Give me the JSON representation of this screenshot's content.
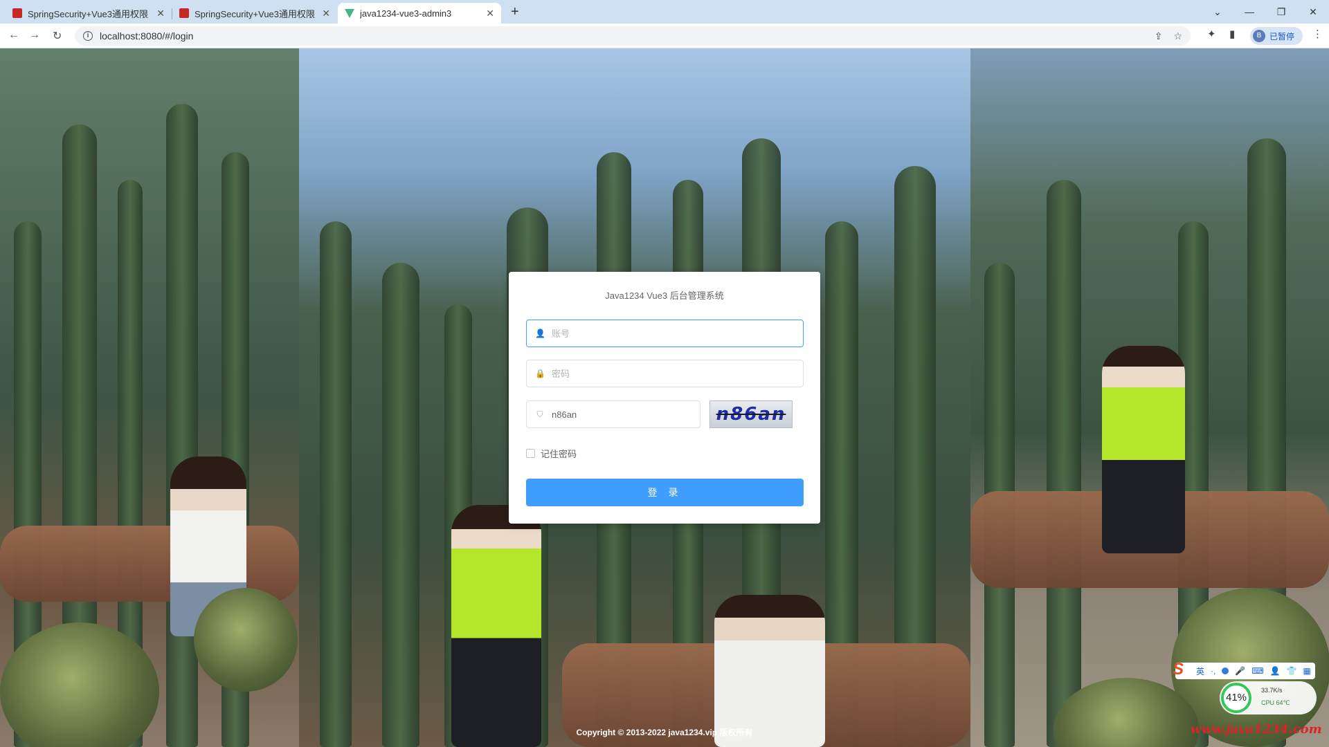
{
  "browser": {
    "tabs": [
      {
        "title": "SpringSecurity+Vue3通用权限",
        "favicon": "red-j-icon",
        "active": false
      },
      {
        "title": "SpringSecurity+Vue3通用权限",
        "favicon": "red-j-icon",
        "active": false
      },
      {
        "title": "java1234-vue3-admin3",
        "favicon": "vue-logo-icon",
        "active": true
      }
    ],
    "url": "localhost:8080/#/login",
    "profile_label": "已暂停",
    "profile_initial": "B"
  },
  "login": {
    "title": "Java1234 Vue3 后台管理系统",
    "username_placeholder": "账号",
    "password_placeholder": "密码",
    "captcha_value": "n86an",
    "captcha_image_text": "n86an",
    "remember_label": "记住密码",
    "login_button": "登 录"
  },
  "footer": {
    "copyright": "Copyright © 2013-2022 java1234.vip 版权所有",
    "watermark": "www.java1234.com"
  },
  "system_tray": {
    "ime_label": "英",
    "cpu_percent": "41%",
    "net_speed": "33.7K/s",
    "cpu_text": "CPU 64℃"
  }
}
